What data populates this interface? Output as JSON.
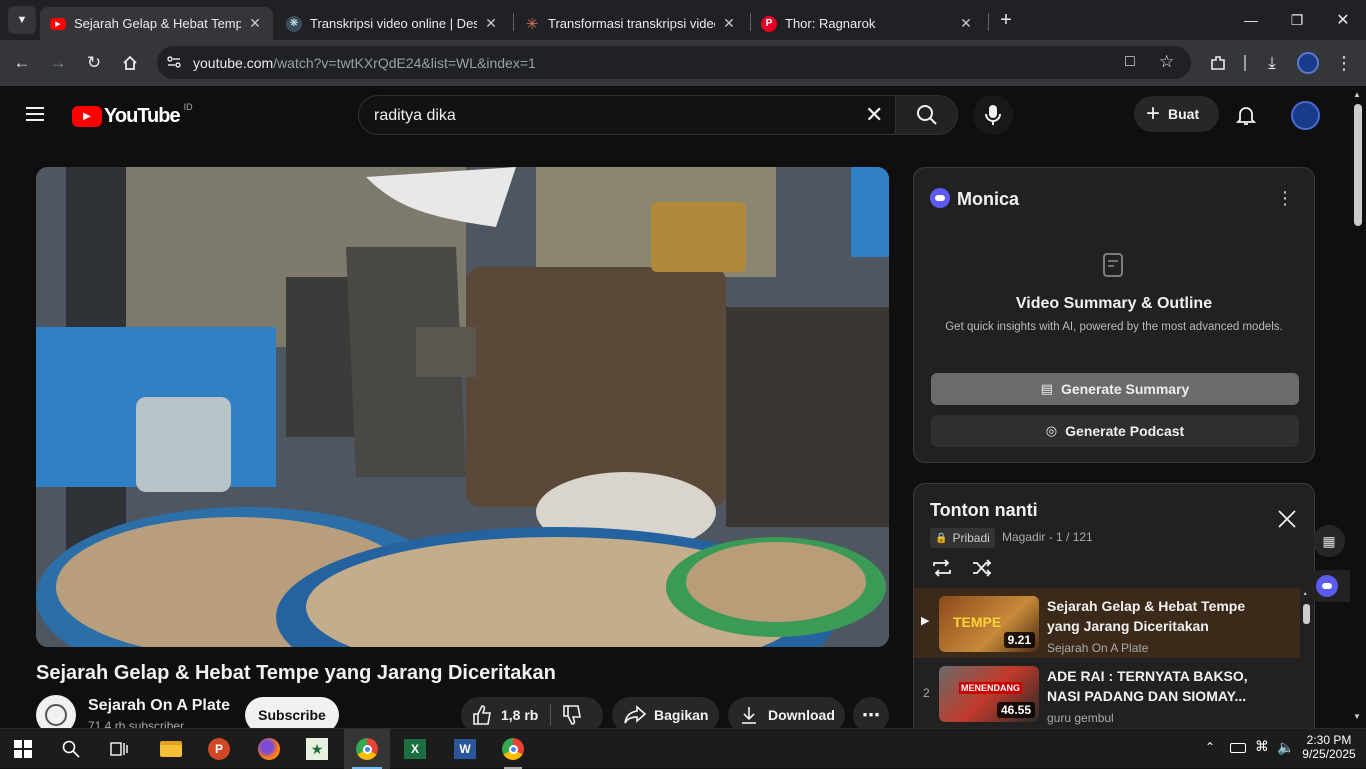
{
  "browser": {
    "tabs": [
      {
        "title": "Sejarah Gelap & Hebat Tempe y",
        "favicon": "youtube-icon",
        "active": true
      },
      {
        "title": "Transkripsi video online | Desgr",
        "favicon": "desgr-icon",
        "active": false
      },
      {
        "title": "Transformasi transkripsi video m",
        "favicon": "claude-icon",
        "active": false
      },
      {
        "title": "Thor: Ragnarok",
        "favicon": "pinterest-icon",
        "active": false
      }
    ],
    "new_tab": "+",
    "url_host": "youtube.com",
    "url_path": "/watch?v=twtKXrQdE24&list=WL&index=1"
  },
  "youtube": {
    "logo_text": "YouTube",
    "region": "ID",
    "search_value": "raditya dika",
    "create_label": "Buat"
  },
  "video": {
    "title": "Sejarah Gelap & Hebat Tempe yang Jarang Diceritakan",
    "channel": "Sejarah On A Plate",
    "subscribers": "71,4 rb subscriber",
    "subscribe_label": "Subscribe",
    "likes": "1,8 rb",
    "share_label": "Bagikan",
    "download_label": "Download"
  },
  "monica": {
    "brand": "Monica",
    "heading": "Video Summary & Outline",
    "subtext": "Get quick insights with AI, powered by the most advanced models.",
    "summary_button": "Generate Summary",
    "podcast_button": "Generate Podcast"
  },
  "playlist": {
    "title": "Tonton nanti",
    "privacy": "Pribadi",
    "meta": "Magadir - 1 / 121",
    "items": [
      {
        "index": "▶",
        "title": "Sejarah Gelap & Hebat Tempe yang Jarang Diceritakan",
        "channel": "Sejarah On A Plate",
        "duration": "9.21",
        "thumb_text": "TEMPE"
      },
      {
        "index": "2",
        "title": "ADE RAI : TERNYATA BAKSO, NASI PADANG DAN SIOMAY...",
        "channel": "guru gembul",
        "duration": "46.55",
        "thumb_text": "MENENDANG"
      }
    ]
  },
  "taskbar": {
    "time": "2:30 PM",
    "date": "9/25/2025"
  },
  "colors": {
    "youtube_red": "#ff0000",
    "monica_primary": "#6b6b6b",
    "playlist_active_bg": "#3b2a1a"
  }
}
